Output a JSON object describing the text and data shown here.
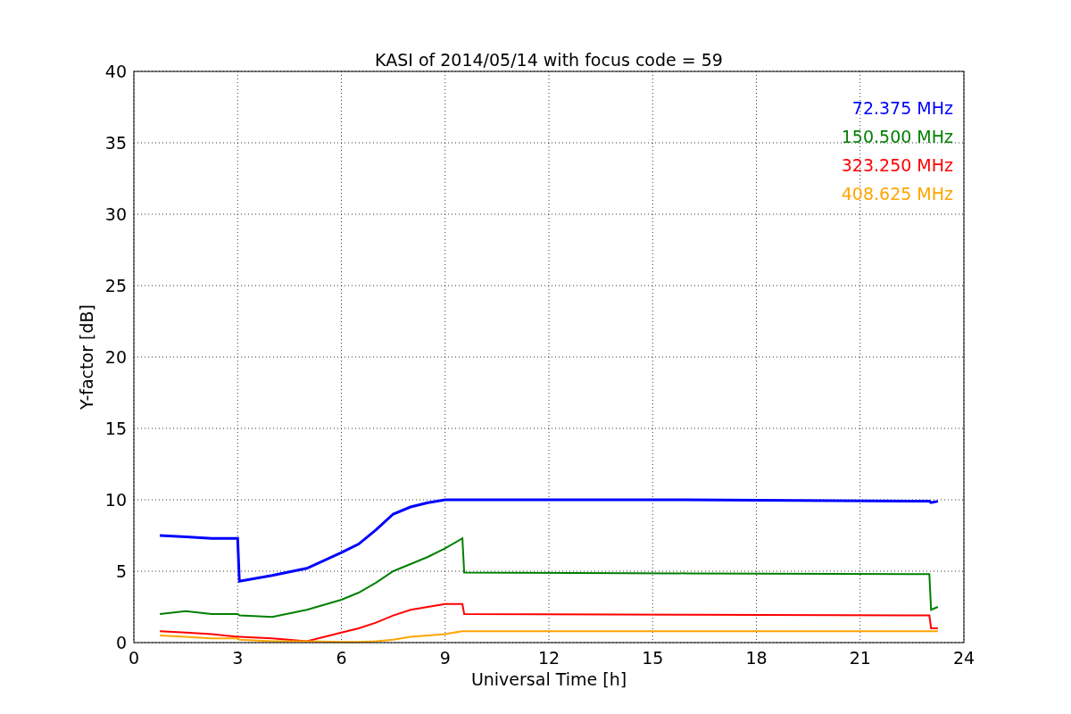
{
  "chart_data": {
    "type": "line",
    "title": "KASI of 2014/05/14 with focus code = 59",
    "xlabel": "Universal Time [h]",
    "ylabel": "Y-factor [dB]",
    "x": [
      0.75,
      1.5,
      2.25,
      3,
      3.05,
      4,
      5,
      6,
      6.5,
      7,
      7.5,
      8,
      8.5,
      9,
      9.5,
      9.55,
      16,
      23,
      23.05,
      23.25
    ],
    "series": [
      {
        "name": "72.375 MHz",
        "color": "#0000ff",
        "values": [
          7.5,
          7.4,
          7.3,
          7.3,
          4.3,
          4.7,
          5.2,
          6.3,
          6.9,
          7.9,
          9.0,
          9.5,
          9.8,
          10.0,
          10.0,
          10.0,
          10.0,
          9.9,
          9.8,
          9.9
        ]
      },
      {
        "name": "150.500 MHz",
        "color": "#008000",
        "values": [
          2.0,
          2.2,
          2.0,
          2.0,
          1.9,
          1.8,
          2.3,
          3.0,
          3.5,
          4.2,
          5.0,
          5.5,
          6.0,
          6.6,
          7.3,
          4.9,
          4.85,
          4.8,
          2.3,
          2.5
        ]
      },
      {
        "name": "323.250 MHz",
        "color": "#ff0000",
        "values": [
          0.8,
          0.7,
          0.6,
          0.4,
          0.4,
          0.3,
          0.1,
          0.7,
          1.0,
          1.4,
          1.9,
          2.3,
          2.5,
          2.7,
          2.7,
          2.0,
          1.95,
          1.9,
          1.0,
          1.0
        ]
      },
      {
        "name": "408.625 MHz",
        "color": "#ffa500",
        "values": [
          0.5,
          0.4,
          0.3,
          0.3,
          0.2,
          0.1,
          0.1,
          0.05,
          0.05,
          0.1,
          0.2,
          0.4,
          0.5,
          0.6,
          0.8,
          0.8,
          0.8,
          0.8,
          0.8,
          0.8
        ]
      }
    ],
    "grid": true,
    "xlim": [
      0,
      24
    ],
    "ylim": [
      0,
      40
    ],
    "xticks": [
      0,
      3,
      6,
      9,
      12,
      15,
      18,
      21,
      24
    ],
    "yticks": [
      0,
      5,
      10,
      15,
      20,
      25,
      30,
      35,
      40
    ]
  }
}
